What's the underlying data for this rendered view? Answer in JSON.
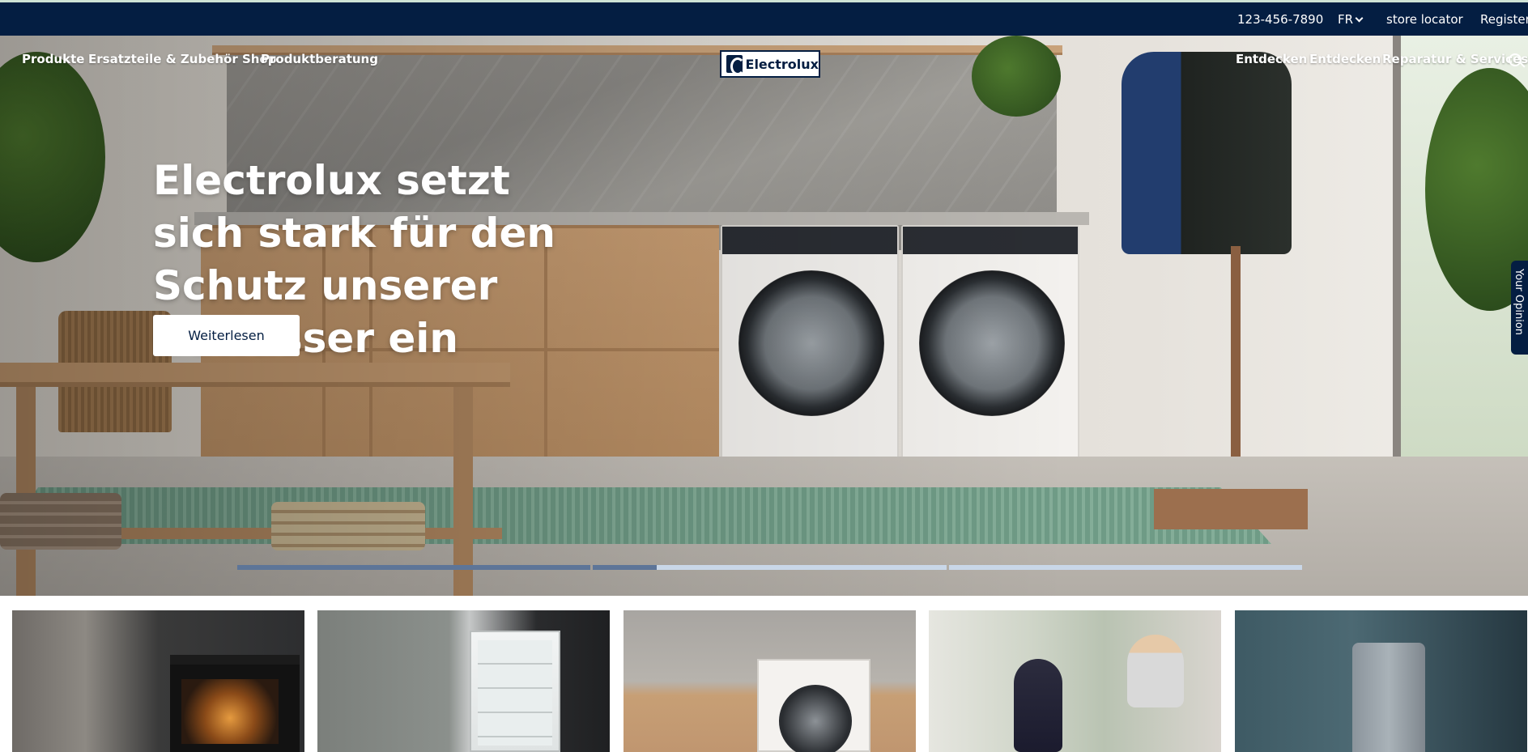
{
  "utility_bar": {
    "phone": "123-456-7890",
    "language": "FR",
    "store_locator": "store locator",
    "register": "Register"
  },
  "nav": {
    "left": [
      "Produkte",
      "Ersatzteile & Zubehör Shop",
      "Produktberatung"
    ],
    "right": [
      "Entdecken",
      "Entdecken",
      "Reparatur & Services"
    ],
    "logo_text": "Electrolux"
  },
  "hero": {
    "headline": "Electrolux setzt sich stark für den Schutz unserer Gewässer ein",
    "cta_label": "Weiterlesen",
    "slides": [
      {
        "progress": 1.0
      },
      {
        "progress": 0.18
      },
      {
        "progress": 0.0
      }
    ]
  },
  "feedback_tab": "Your Opinion",
  "tiles": [
    {
      "name": "oven"
    },
    {
      "name": "fridge"
    },
    {
      "name": "washer"
    },
    {
      "name": "vacuum"
    },
    {
      "name": "air-purifier"
    }
  ],
  "colors": {
    "brand_navy": "#041e42",
    "progress_fill": "#5d7598",
    "progress_track": "#c9d7e8",
    "accent_line": "#cfe3d6"
  }
}
